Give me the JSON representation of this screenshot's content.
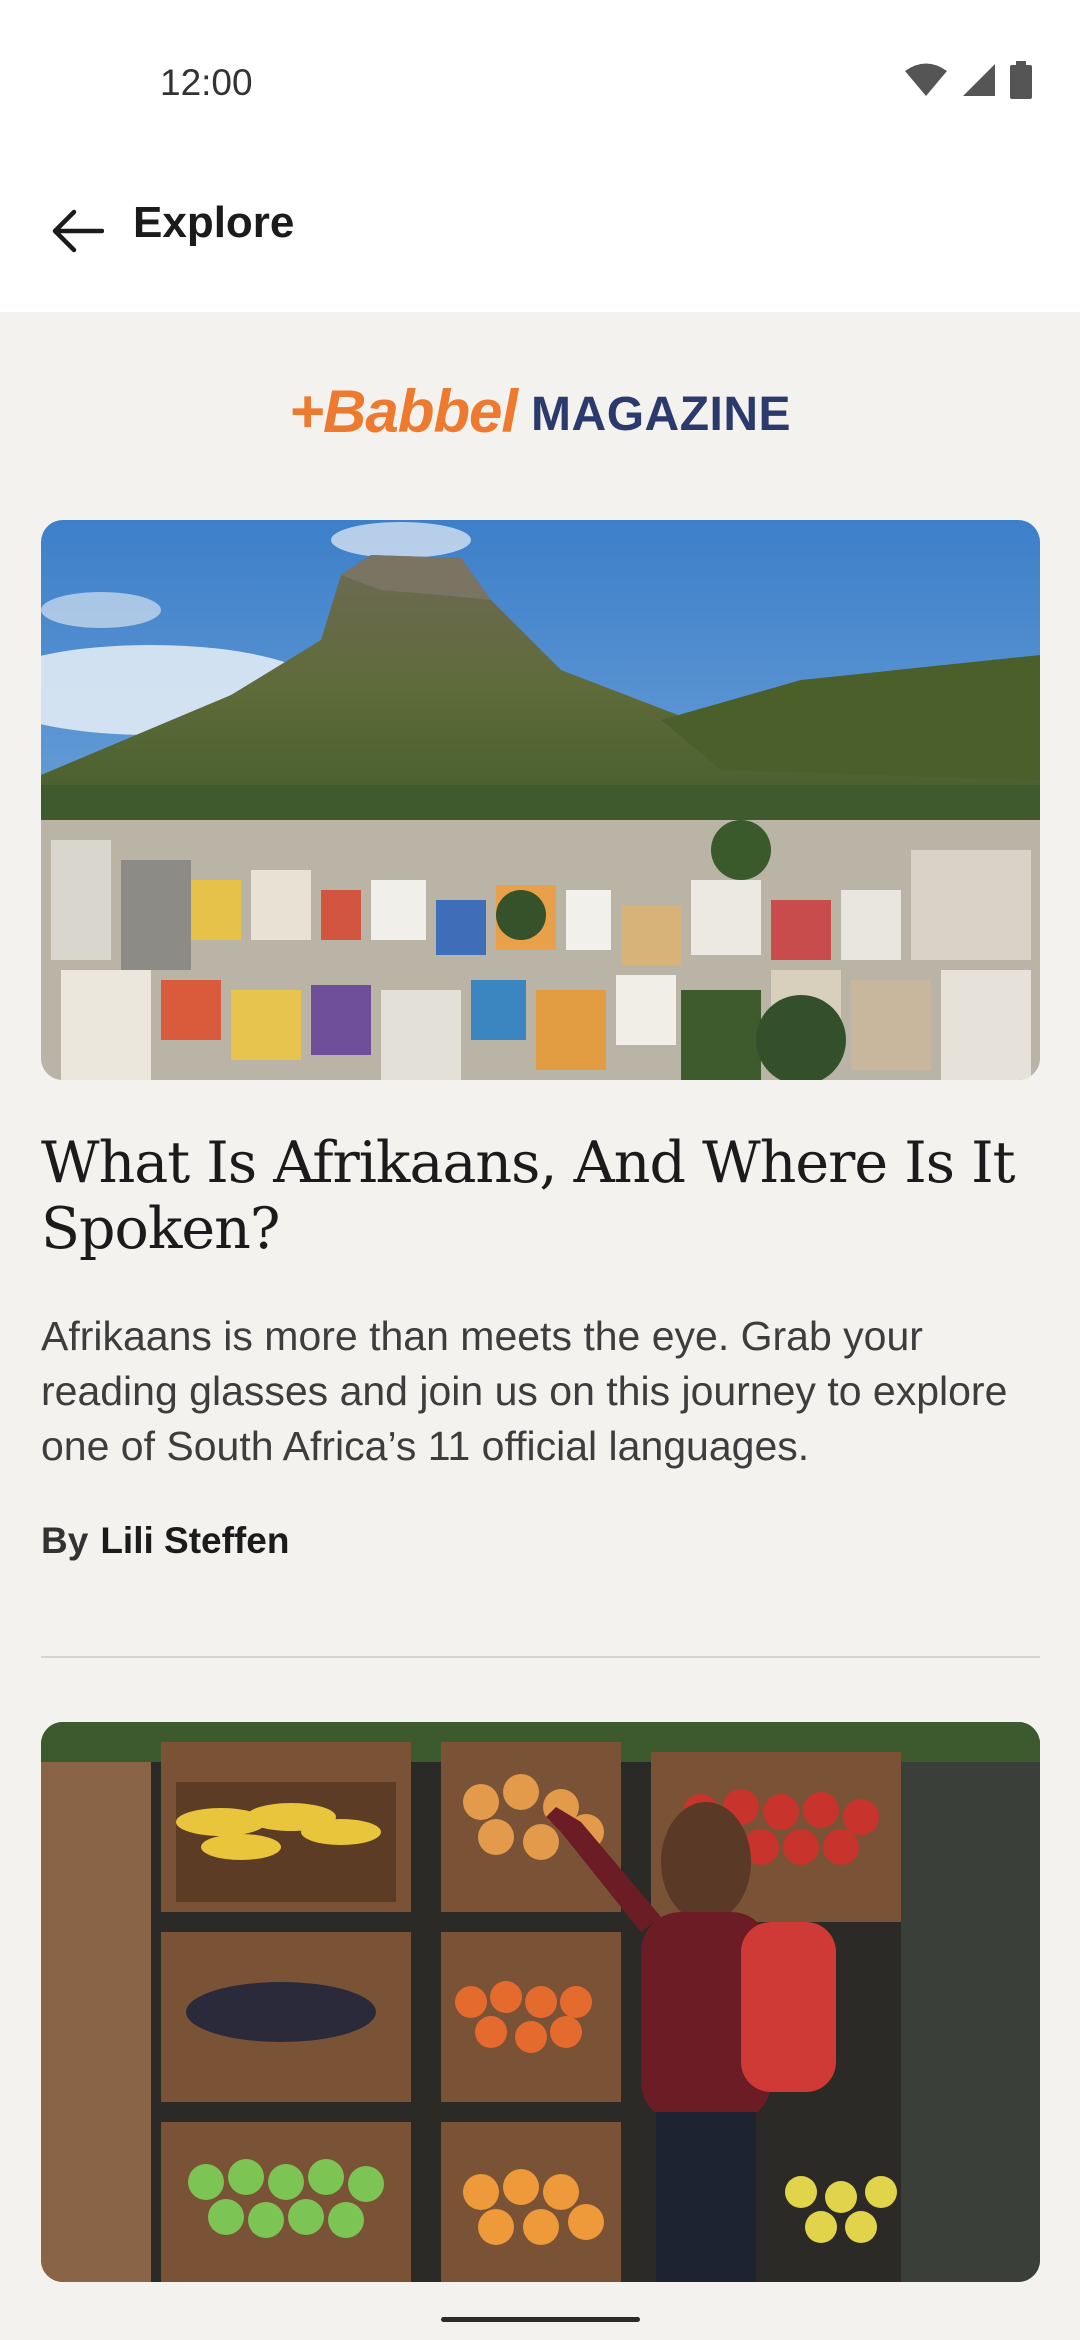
{
  "status_bar": {
    "time": "12:00",
    "icons": [
      "wifi-icon",
      "signal-icon",
      "battery-icon"
    ]
  },
  "app_bar": {
    "title": "Explore",
    "back_icon": "arrow-back-icon"
  },
  "brand": {
    "name": "+Babbel",
    "suffix": "MAGAZINE",
    "colors": {
      "babbel": "#ee7a2f",
      "magazine": "#2a3a6c"
    }
  },
  "articles": [
    {
      "image": "Cape Town colorful houses and Lion's Head mountain",
      "title": "What Is Afrikaans, And Where Is It Spoken?",
      "description": "Afrikaans is more than meets the eye. Grab your reading glasses and join us on this journey to explore one of South Africa’s 11 official languages.",
      "byline_prefix": "By",
      "author": "Lili Steffen"
    },
    {
      "image": "Woman picking fruit from crates at a market stall"
    }
  ],
  "colors": {
    "background": "#f4f2ef",
    "appbar": "#ffffff",
    "accent_orange": "#ee7a2f",
    "accent_navy": "#2a3a6c"
  }
}
